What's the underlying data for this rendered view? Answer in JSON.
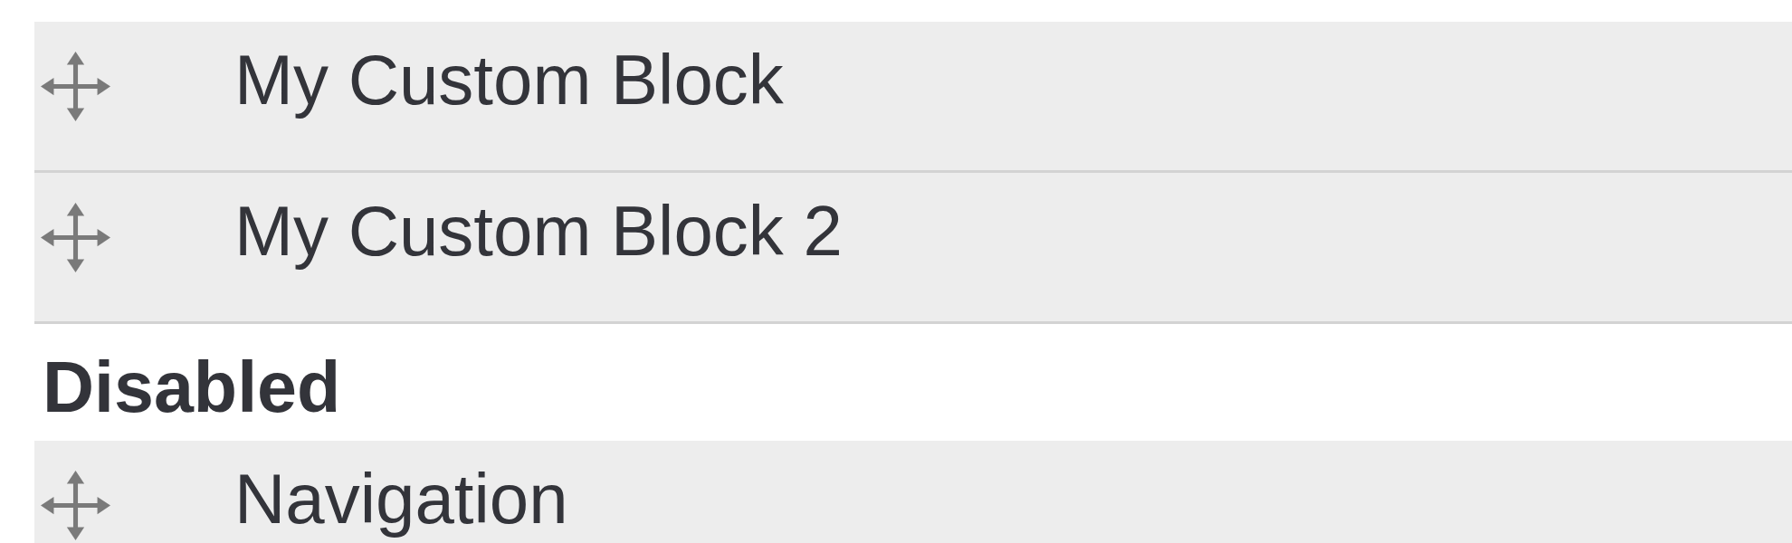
{
  "groups": [
    {
      "blocks": [
        {
          "label": "My Custom Block"
        },
        {
          "label": "My Custom Block 2"
        }
      ]
    },
    {
      "heading": "Disabled",
      "blocks": [
        {
          "label": "Navigation"
        }
      ]
    }
  ]
}
